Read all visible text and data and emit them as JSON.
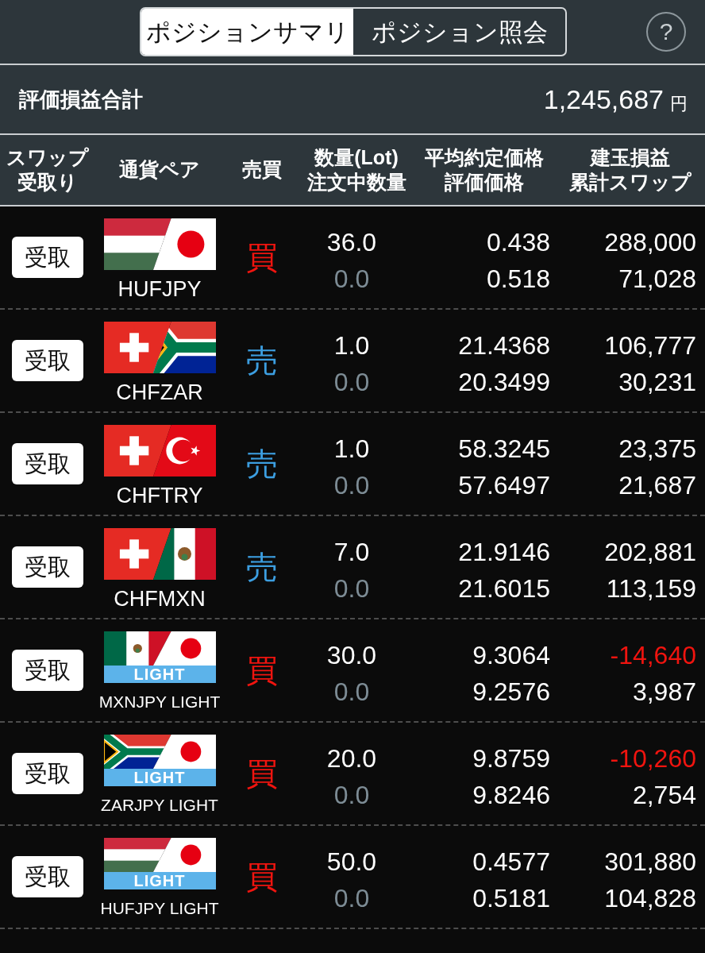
{
  "tabs": [
    {
      "label": "ポジションサマリ",
      "selected": true
    },
    {
      "label": "ポジション照会",
      "selected": false
    }
  ],
  "help_button": {
    "label": "?"
  },
  "summary": {
    "label": "評価損益合計",
    "value": "1,245,687",
    "unit": "円"
  },
  "table": {
    "columns": [
      {
        "lines": [
          "スワップ",
          "受取り"
        ]
      },
      {
        "lines": [
          "通貨ペア"
        ]
      },
      {
        "lines": [
          "売買"
        ]
      },
      {
        "lines": [
          "数量(Lot)",
          "注文中数量"
        ]
      },
      {
        "lines": [
          "平均約定価格",
          "評価価格"
        ]
      },
      {
        "lines": [
          "建玉損益",
          "累計スワップ"
        ]
      }
    ],
    "rows": [
      {
        "swap_button": "受取",
        "pair": "HUFJPY",
        "side": {
          "label": "買",
          "kind": "buy"
        },
        "quantity": "36.0",
        "ordered_quantity": "0.0",
        "average_price": "0.438",
        "valuation_price": "0.518",
        "position_pnl": {
          "value": "288,000",
          "loss": false
        },
        "cumulative_swap": "71,028"
      },
      {
        "swap_button": "受取",
        "pair": "CHFZAR",
        "side": {
          "label": "売",
          "kind": "sell"
        },
        "quantity": "1.0",
        "ordered_quantity": "0.0",
        "average_price": "21.4368",
        "valuation_price": "20.3499",
        "position_pnl": {
          "value": "106,777",
          "loss": false
        },
        "cumulative_swap": "30,231"
      },
      {
        "swap_button": "受取",
        "pair": "CHFTRY",
        "side": {
          "label": "売",
          "kind": "sell"
        },
        "quantity": "1.0",
        "ordered_quantity": "0.0",
        "average_price": "58.3245",
        "valuation_price": "57.6497",
        "position_pnl": {
          "value": "23,375",
          "loss": false
        },
        "cumulative_swap": "21,687"
      },
      {
        "swap_button": "受取",
        "pair": "CHFMXN",
        "side": {
          "label": "売",
          "kind": "sell"
        },
        "quantity": "7.0",
        "ordered_quantity": "0.0",
        "average_price": "21.9146",
        "valuation_price": "21.6015",
        "position_pnl": {
          "value": "202,881",
          "loss": false
        },
        "cumulative_swap": "113,159"
      },
      {
        "swap_button": "受取",
        "badge": "LIGHT",
        "pair": "MXNJPY LIGHT",
        "side": {
          "label": "買",
          "kind": "buy"
        },
        "quantity": "30.0",
        "ordered_quantity": "0.0",
        "average_price": "9.3064",
        "valuation_price": "9.2576",
        "position_pnl": {
          "value": "-14,640",
          "loss": true
        },
        "cumulative_swap": "3,987"
      },
      {
        "swap_button": "受取",
        "badge": "LIGHT",
        "pair": "ZARJPY LIGHT",
        "side": {
          "label": "買",
          "kind": "buy"
        },
        "quantity": "20.0",
        "ordered_quantity": "0.0",
        "average_price": "9.8759",
        "valuation_price": "9.8246",
        "position_pnl": {
          "value": "-10,260",
          "loss": true
        },
        "cumulative_swap": "2,754"
      },
      {
        "swap_button": "受取",
        "badge": "LIGHT",
        "pair": "HUFJPY LIGHT",
        "side": {
          "label": "買",
          "kind": "buy"
        },
        "quantity": "50.0",
        "ordered_quantity": "0.0",
        "average_price": "0.4577",
        "valuation_price": "0.5181",
        "position_pnl": {
          "value": "301,880",
          "loss": false
        },
        "cumulative_swap": "104,828"
      }
    ]
  }
}
